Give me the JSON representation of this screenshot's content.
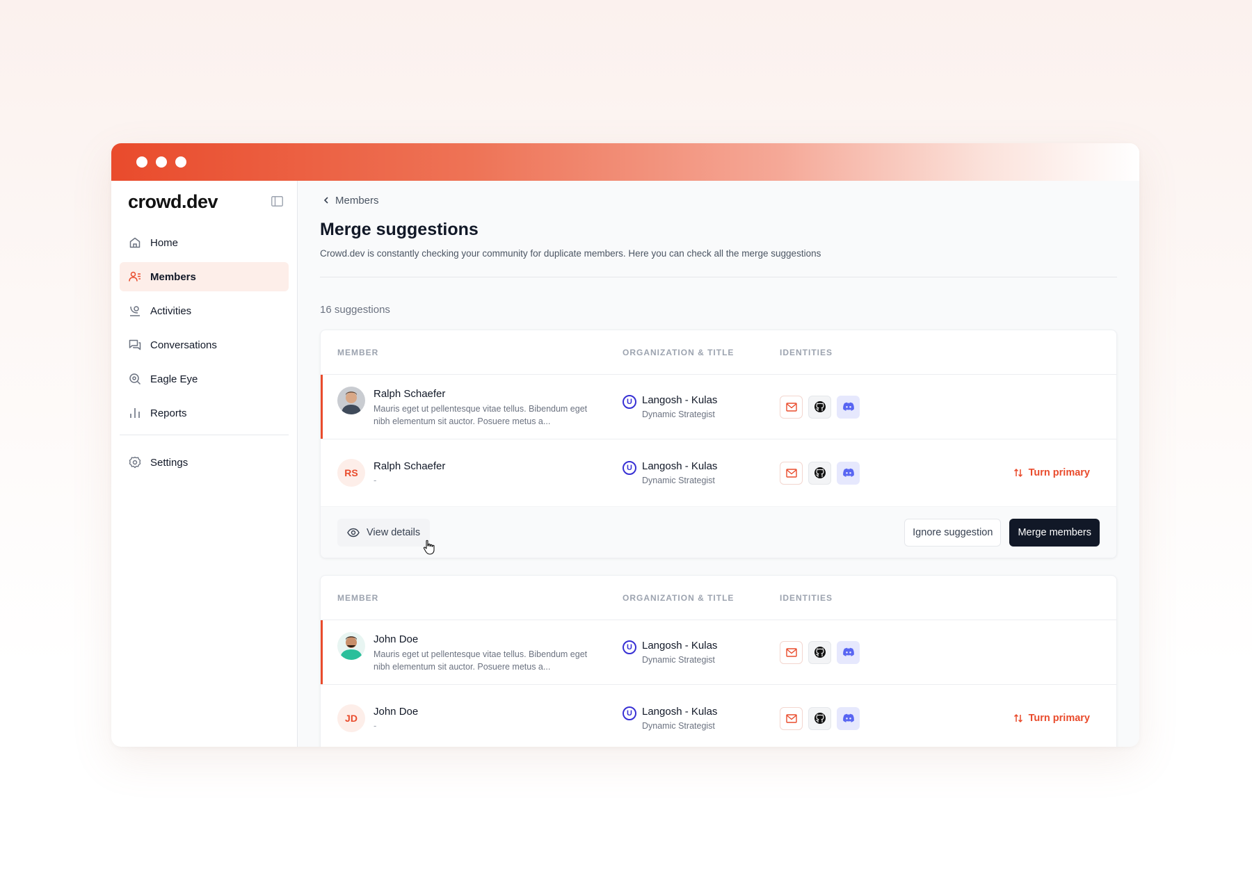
{
  "app": {
    "logo": "crowd.dev"
  },
  "sidebar": {
    "items": [
      {
        "label": "Home",
        "icon": "home-icon",
        "active": false
      },
      {
        "label": "Members",
        "icon": "members-icon",
        "active": true
      },
      {
        "label": "Activities",
        "icon": "activities-icon",
        "active": false
      },
      {
        "label": "Conversations",
        "icon": "conversations-icon",
        "active": false
      },
      {
        "label": "Eagle Eye",
        "icon": "eagle-eye-icon",
        "active": false
      },
      {
        "label": "Reports",
        "icon": "reports-icon",
        "active": false
      }
    ],
    "settings": {
      "label": "Settings",
      "icon": "gear-icon"
    }
  },
  "header": {
    "breadcrumb": "Members",
    "title": "Merge suggestions",
    "description": "Crowd.dev is constantly checking your community for duplicate members. Here you can check all the merge suggestions"
  },
  "suggestions": {
    "count_label": "16 suggestions",
    "columns": {
      "member": "MEMBER",
      "org": "ORGANIZATION & TITLE",
      "identities": "IDENTITIES"
    },
    "turn_primary_label": "Turn primary",
    "view_details_label": "View details",
    "ignore_label": "Ignore suggestion",
    "merge_label": "Merge members",
    "cards": [
      {
        "primary": {
          "name": "Ralph Schaefer",
          "bio": "Mauris eget ut pellentesque vitae tellus. Bibendum eget nibh elementum sit auctor. Posuere metus a...",
          "org": "Langosh - Kulas",
          "org_logo_letter": "U",
          "title": "Dynamic Strategist"
        },
        "secondary": {
          "name": "Ralph Schaefer",
          "initials": "RS",
          "bio": "-",
          "org": "Langosh - Kulas",
          "org_logo_letter": "U",
          "title": "Dynamic Strategist"
        }
      },
      {
        "primary": {
          "name": "John Doe",
          "bio": "Mauris eget ut pellentesque vitae tellus. Bibendum eget nibh elementum sit auctor. Posuere metus a...",
          "org": "Langosh - Kulas",
          "org_logo_letter": "U",
          "title": "Dynamic Strategist"
        },
        "secondary": {
          "name": "John Doe",
          "initials": "JD",
          "bio": "-",
          "org": "Langosh - Kulas",
          "org_logo_letter": "U",
          "title": "Dynamic Strategist"
        }
      }
    ]
  },
  "colors": {
    "accent": "#e94b2c",
    "dark": "#111827",
    "org_logo": "#3730d4",
    "discord": "#5865f2"
  }
}
